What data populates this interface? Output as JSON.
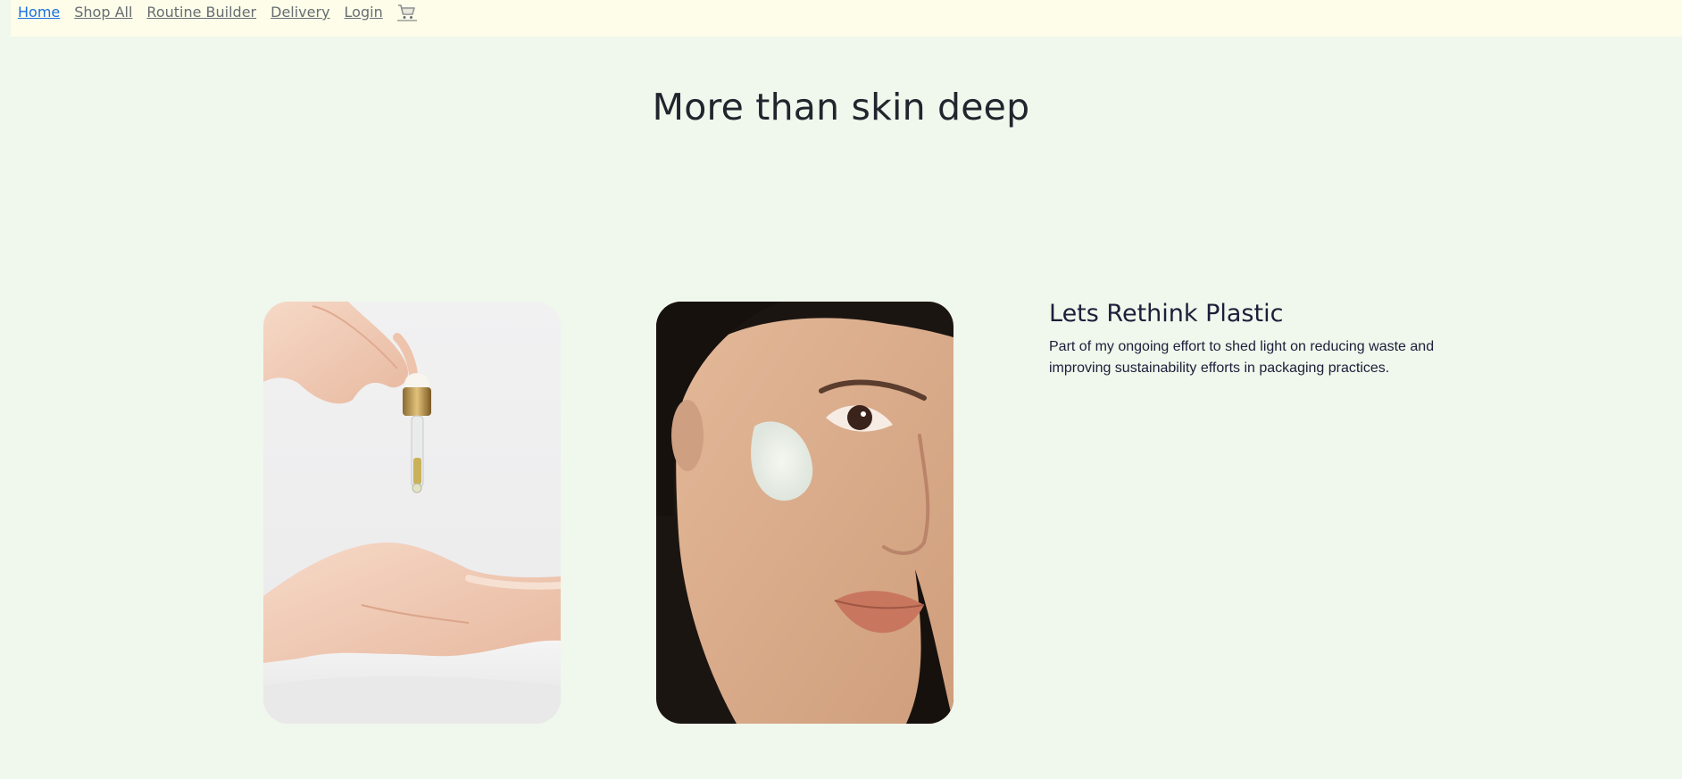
{
  "nav": {
    "items": [
      {
        "label": "Home"
      },
      {
        "label": "Shop All"
      },
      {
        "label": "Routine Builder"
      },
      {
        "label": "Delivery"
      },
      {
        "label": "Login"
      }
    ],
    "cart_icon": "cart-icon",
    "active_color": "#1a6fe0",
    "link_color": "#666e73",
    "background": "#fefde9"
  },
  "hero": {
    "title": "More than skin deep"
  },
  "images": {
    "left": "hands-serum-dropper-photo",
    "right": "woman-face-cream-photo"
  },
  "article": {
    "title": "Lets Rethink Plastic",
    "body": "Part of my ongoing effort to shed light on reducing waste and improving sustainability efforts in packaging practices."
  },
  "colors": {
    "page_background": "#f0f7ec",
    "heading": "#20262d",
    "article_text": "#1c1f3a"
  }
}
